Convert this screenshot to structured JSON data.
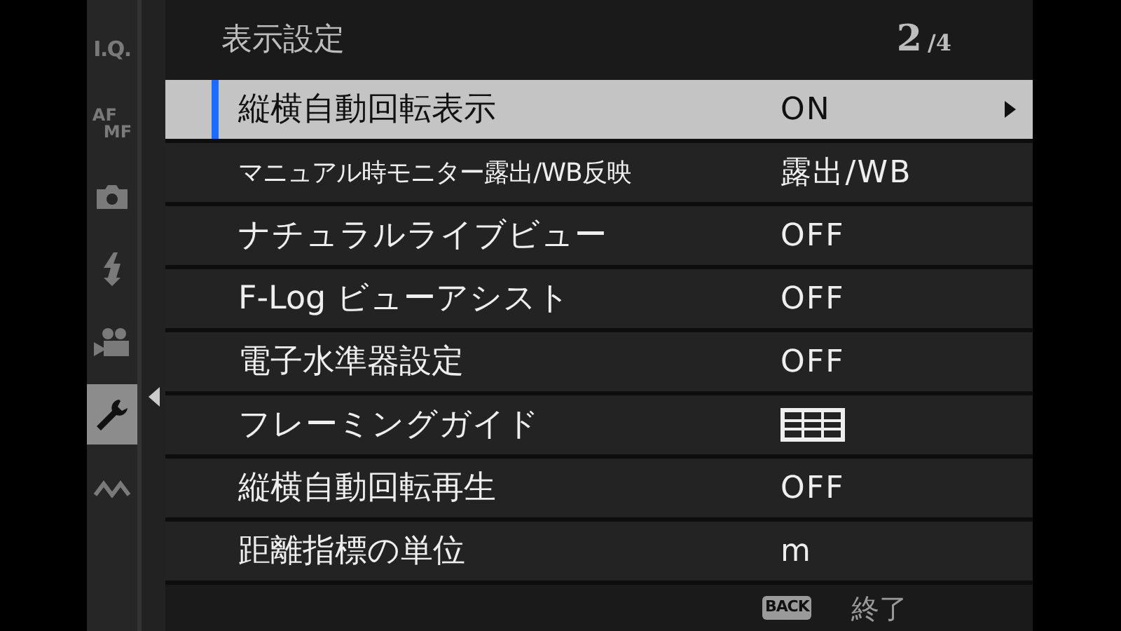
{
  "sidebar": {
    "items": [
      {
        "kind": "text",
        "label": "I.Q.",
        "selected": false
      },
      {
        "kind": "afmf",
        "label": "AF",
        "label2": "MF",
        "selected": false
      },
      {
        "kind": "camera",
        "selected": false
      },
      {
        "kind": "flash",
        "selected": false
      },
      {
        "kind": "movie",
        "selected": false
      },
      {
        "kind": "wrench",
        "selected": true
      },
      {
        "kind": "connection",
        "selected": false
      }
    ]
  },
  "header": {
    "title": "表示設定",
    "page": "2",
    "total": "/4"
  },
  "menu": {
    "items": [
      {
        "label": "縦横自動回転表示",
        "value": "ON",
        "kind": "text",
        "selected": true
      },
      {
        "label": "マニュアル時モニター露出/WB反映",
        "value": "露出/WB",
        "kind": "text",
        "selected": false
      },
      {
        "label": "ナチュラルライブビュー",
        "value": "OFF",
        "kind": "text",
        "selected": false
      },
      {
        "label": "F-Log ビューアシスト",
        "value": "OFF",
        "kind": "text",
        "selected": false
      },
      {
        "label": "電子水準器設定",
        "value": "OFF",
        "kind": "text",
        "selected": false
      },
      {
        "label": "フレーミングガイド",
        "kind": "grid",
        "selected": false
      },
      {
        "label": "縦横自動回転再生",
        "value": "OFF",
        "kind": "text",
        "selected": false
      },
      {
        "label": "距離指標の単位",
        "value": "m",
        "kind": "text",
        "selected": false
      }
    ]
  },
  "footer": {
    "key": "BACK",
    "action": "終了"
  }
}
